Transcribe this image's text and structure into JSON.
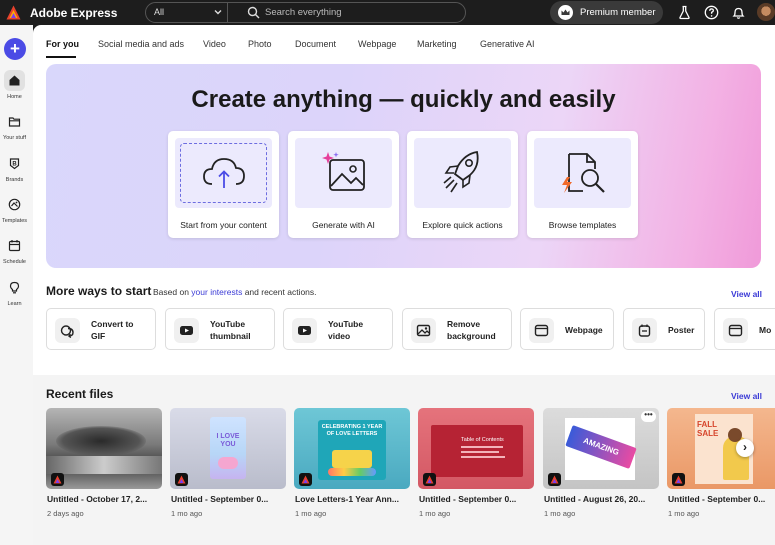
{
  "app": {
    "title": "Adobe Express"
  },
  "search": {
    "filter_value": "All",
    "placeholder": "Search everything"
  },
  "header": {
    "premium_label": "Premium member"
  },
  "rail": {
    "items": [
      {
        "label": "Home",
        "icon": "home-icon"
      },
      {
        "label": "Your stuff",
        "icon": "folder-icon"
      },
      {
        "label": "Brands",
        "icon": "brand-icon"
      },
      {
        "label": "Templates",
        "icon": "templates-icon"
      },
      {
        "label": "Schedule",
        "icon": "calendar-icon"
      },
      {
        "label": "Learn",
        "icon": "lightbulb-icon"
      }
    ]
  },
  "tabs": [
    "For you",
    "Social media and ads",
    "Video",
    "Photo",
    "Document",
    "Webpage",
    "Marketing",
    "Generative AI"
  ],
  "hero": {
    "title": "Create anything — quickly and easily",
    "cards": [
      {
        "label": "Start from your content",
        "icon": "cloud-upload-icon"
      },
      {
        "label": "Generate with AI",
        "icon": "ai-image-icon"
      },
      {
        "label": "Explore quick actions",
        "icon": "rocket-icon"
      },
      {
        "label": "Browse templates",
        "icon": "template-search-icon"
      }
    ]
  },
  "ways": {
    "title": "More ways to start",
    "sub_prefix": "Based on",
    "sub_link": "your interests",
    "sub_suffix": "and recent actions.",
    "view_all": "View all",
    "items": [
      {
        "line1": "Convert to",
        "line2": "GIF"
      },
      {
        "line1": "YouTube",
        "line2": "thumbnail"
      },
      {
        "line1": "YouTube",
        "line2": "video"
      },
      {
        "line1": "Remove",
        "line2": "background"
      },
      {
        "line1": "Webpage",
        "line2": ""
      },
      {
        "line1": "Poster",
        "line2": ""
      },
      {
        "line1": "Mo",
        "line2": ""
      }
    ]
  },
  "recent": {
    "title": "Recent files",
    "view_all": "View all",
    "files": [
      {
        "name": "Untitled - October 17, 2...",
        "date": "2 days ago"
      },
      {
        "name": "Untitled - September 0...",
        "date": "1 mo ago",
        "thumb_text": "I LOVE YOU"
      },
      {
        "name": "Love Letters-1 Year Ann...",
        "date": "1 mo ago",
        "thumb_text": "CELEBRATING 1 YEAR OF LOVE LETTERS"
      },
      {
        "name": "Untitled - September 0...",
        "date": "1 mo ago",
        "thumb_text": "Table of Contents"
      },
      {
        "name": "Untitled - August 26, 20...",
        "date": "1 mo ago",
        "thumb_text": "AMAZING"
      },
      {
        "name": "Untitled - September 0...",
        "date": "1 mo ago",
        "thumb_text": "FALL SALE"
      }
    ]
  },
  "colors": {
    "accent": "#4b4be5",
    "link": "#3b3bd6",
    "topbar": "#1d1d1d"
  }
}
